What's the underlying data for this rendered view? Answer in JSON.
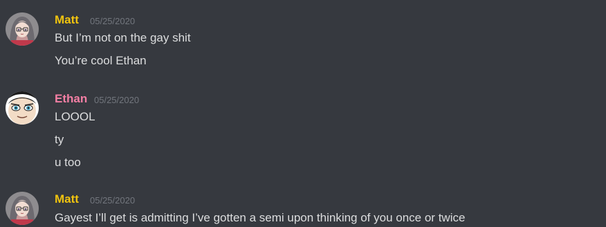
{
  "colors": {
    "background": "#36393f",
    "text": "#dcddde",
    "timestamp": "#72767d",
    "matt": "#f1c40f",
    "ethan": "#f47fa4"
  },
  "messages": [
    {
      "author": "Matt",
      "timestamp": "05/25/2020",
      "avatar_icon": "anime-girl-avatar-icon",
      "lines": [
        "But I’m not on the gay shit",
        "You’re cool Ethan"
      ]
    },
    {
      "author": "Ethan",
      "timestamp": "05/25/2020",
      "avatar_icon": "cartoon-face-avatar-icon",
      "lines": [
        "LOOOL",
        "ty",
        "u too"
      ]
    },
    {
      "author": "Matt",
      "timestamp": "05/25/2020",
      "avatar_icon": "anime-girl-avatar-icon",
      "lines": [
        "Gayest I’ll get is admitting I’ve gotten a semi upon thinking of you once or twice"
      ]
    }
  ]
}
